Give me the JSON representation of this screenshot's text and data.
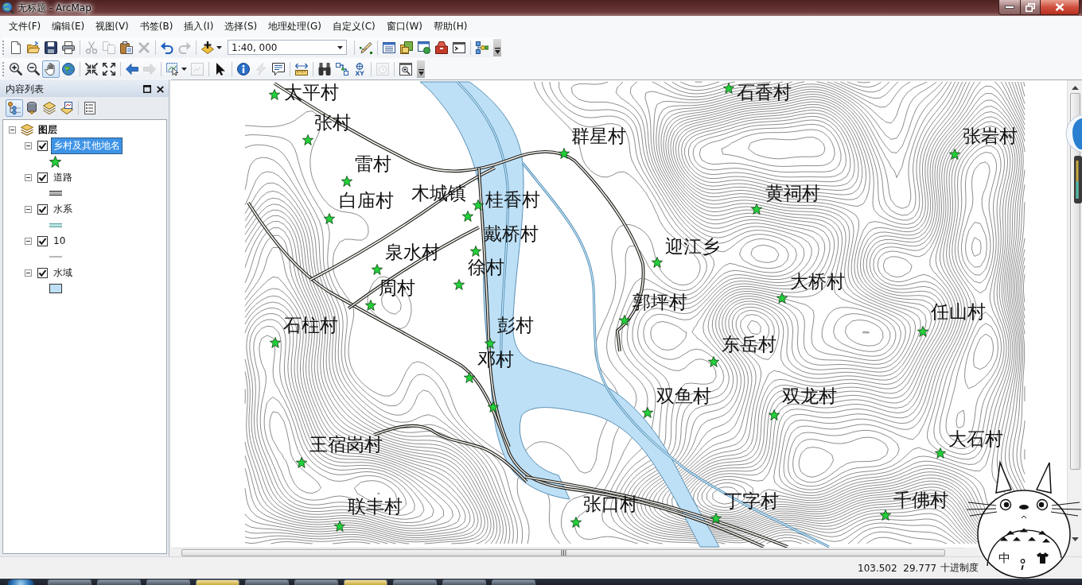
{
  "window": {
    "title": "无标题 - ArcMap"
  },
  "menu": [
    "文件(F)",
    "编辑(E)",
    "视图(V)",
    "书签(B)",
    "插入(I)",
    "选择(S)",
    "地理处理(G)",
    "自定义(C)",
    "窗口(W)",
    "帮助(H)"
  ],
  "toolbars": [
    {
      "scale": "1:40, 000",
      "groups": [
        [
          {
            "disabled": false
          },
          {
            "disabled": false
          },
          {
            "disabled": false
          },
          {
            "disabled": false
          }
        ],
        [
          {
            "disabled": true
          },
          {
            "disabled": true
          },
          {
            "disabled": false
          },
          {
            "disabled": true
          }
        ],
        [
          {
            "disabled": false
          },
          {
            "disabled": true
          }
        ],
        [
          {
            "disabled": false
          }
        ],
        [
          {
            "disabled": false
          }
        ],
        [
          {
            "disabled": false
          },
          {
            "disabled": false
          },
          {
            "disabled": false
          },
          {
            "disabled": false
          },
          {
            "disabled": false
          }
        ],
        [
          {
            "disabled": false
          }
        ]
      ]
    },
    {
      "groups": [
        [
          {
            "disabled": false,
            "selected": false
          },
          {
            "disabled": false,
            "selected": false
          },
          {
            "disabled": false,
            "selected": true
          },
          {
            "disabled": false,
            "selected": false
          }
        ],
        [
          {
            "disabled": false,
            "selected": false
          },
          {
            "disabled": false,
            "selected": false
          }
        ],
        [
          {
            "disabled": false,
            "selected": false
          },
          {
            "disabled": true,
            "selected": false
          }
        ],
        [
          {
            "disabled": false,
            "selected": false
          },
          {
            "disabled": true,
            "selected": false
          }
        ],
        [
          {
            "disabled": false,
            "selected": false
          }
        ],
        [
          {
            "disabled": false,
            "selected": false
          },
          {
            "disabled": true,
            "selected": false
          },
          {
            "disabled": false,
            "selected": false
          }
        ],
        [
          {
            "disabled": false,
            "selected": false
          }
        ],
        [
          {
            "disabled": false,
            "selected": false
          },
          {
            "disabled": false,
            "selected": false
          },
          {
            "disabled": false,
            "selected": false,
            "caption": "XY"
          }
        ],
        [
          {
            "disabled": true,
            "selected": false
          }
        ],
        [
          {
            "disabled": false,
            "selected": false
          }
        ]
      ]
    }
  ],
  "toc": {
    "title": "内容列表",
    "tools": [
      {
        "selected": true
      },
      {
        "selected": false
      },
      {
        "selected": false
      },
      {
        "selected": false
      },
      {
        "selected": false
      }
    ],
    "root": {
      "label": "图层",
      "expanded": true,
      "children": [
        {
          "label": "乡村及其他地名",
          "checked": true,
          "expanded": true,
          "selected": true,
          "kind": "point"
        },
        {
          "label": "道路",
          "checked": true,
          "expanded": true,
          "selected": false,
          "kind": "road"
        },
        {
          "label": "水系",
          "checked": true,
          "expanded": true,
          "selected": false,
          "kind": "stream"
        },
        {
          "label": "10",
          "checked": true,
          "expanded": true,
          "selected": false,
          "kind": "contour"
        },
        {
          "label": "水域",
          "checked": true,
          "expanded": true,
          "selected": false,
          "kind": "area"
        }
      ]
    }
  },
  "map": {
    "places": [
      "太平村",
      "石香村",
      "张村",
      "群星村",
      "张岩村",
      "雷村",
      "白庙村",
      "木城镇",
      "桂香村",
      "黄祠村",
      "戴桥村",
      "泉水村",
      "迎江乡",
      "徐村",
      "周村",
      "大桥村",
      "郭坪村",
      "任山村",
      "石柱村",
      "彭村",
      "东岳村",
      "邓村",
      "双鱼村",
      "双龙村",
      "王宿岗村",
      "大石村",
      "联丰村",
      "张口村",
      "丁字村",
      "千佛村"
    ]
  },
  "status_bar": {
    "coordinates": "103.502  29.777",
    "units": "十进制度"
  },
  "ime_widget": {
    "mode": "中"
  }
}
